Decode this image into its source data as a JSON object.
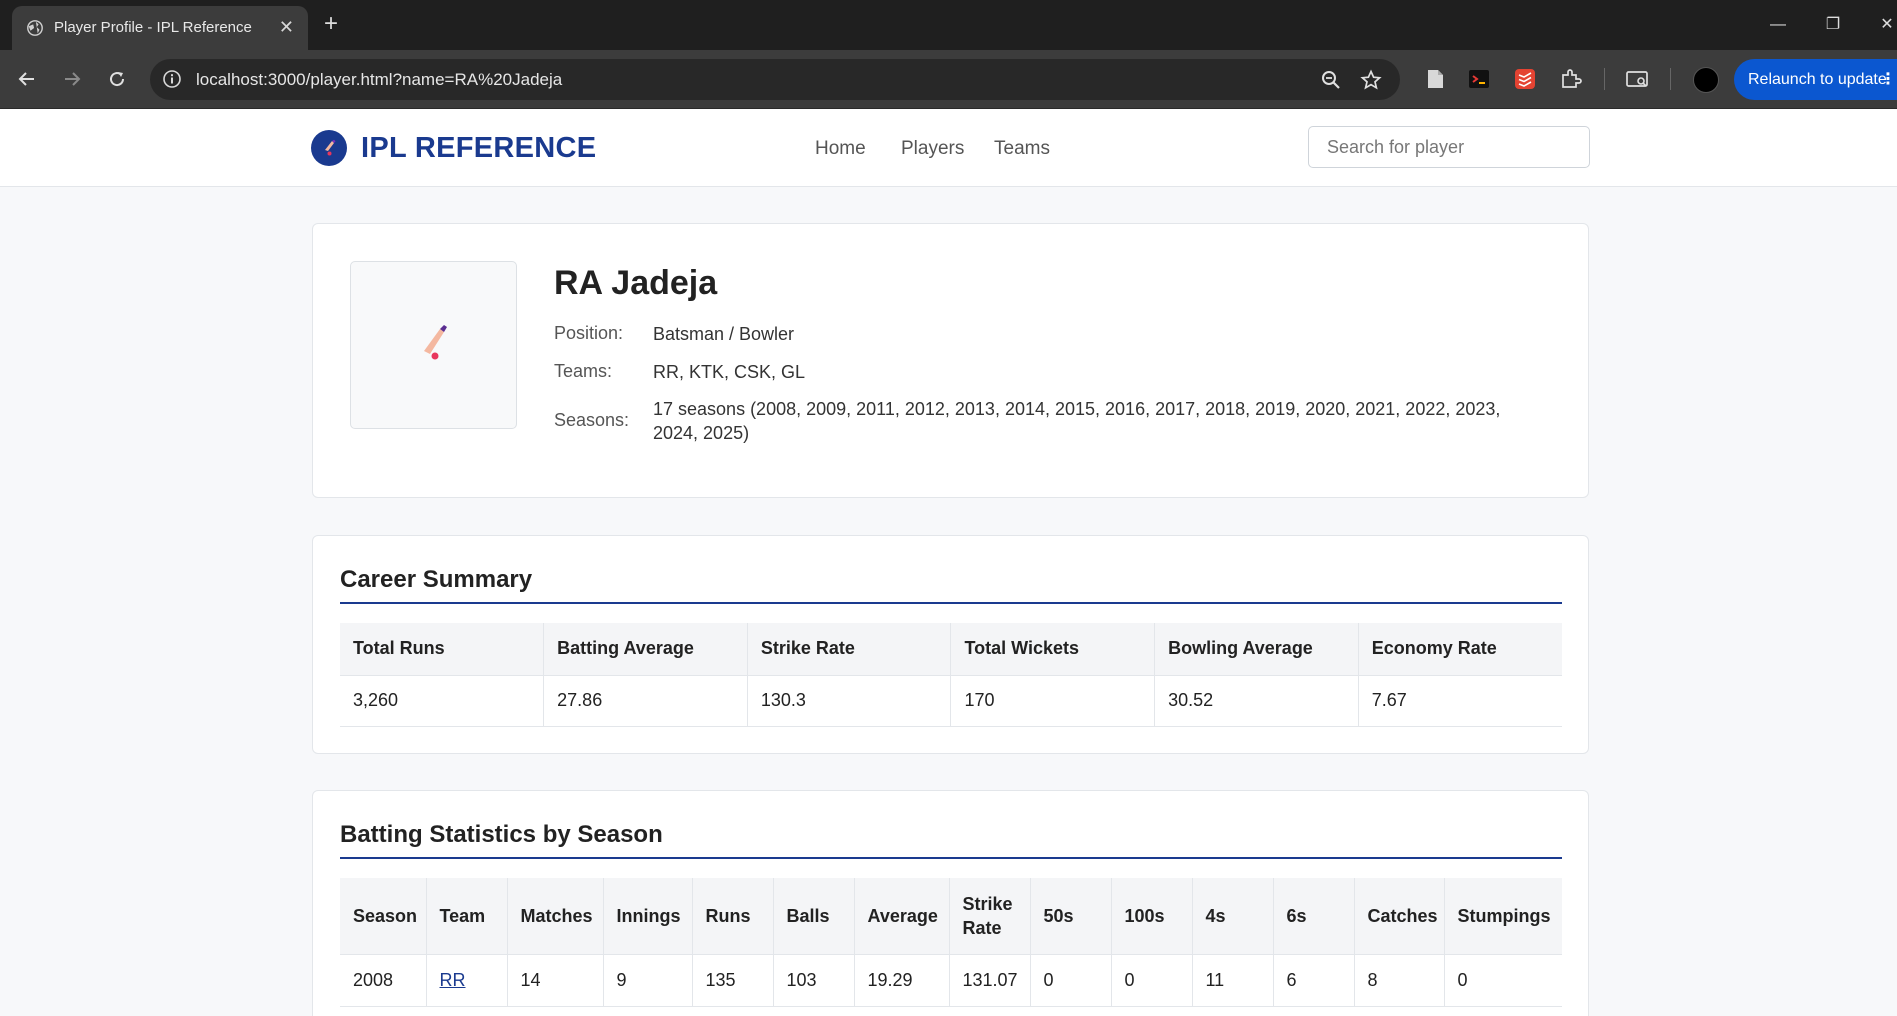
{
  "browser": {
    "tab_title": "Player Profile - IPL Reference",
    "url": "localhost:3000/player.html?name=RA%20Jadeja",
    "relaunch_label": "Relaunch to update"
  },
  "site": {
    "logo_text": "IPL REFERENCE",
    "nav": [
      "Home",
      "Players",
      "Teams"
    ],
    "search_placeholder": "Search for player"
  },
  "player": {
    "name": "RA Jadeja",
    "position_label": "Position:",
    "position": "Batsman / Bowler",
    "teams_label": "Teams:",
    "teams": "RR, KTK, CSK, GL",
    "seasons_label": "Seasons:",
    "seasons": "17 seasons (2008, 2009, 2011, 2012, 2013, 2014, 2015, 2016, 2017, 2018, 2019, 2020, 2021, 2022, 2023, 2024, 2025)"
  },
  "career_summary": {
    "title": "Career Summary",
    "headers": [
      "Total Runs",
      "Batting Average",
      "Strike Rate",
      "Total Wickets",
      "Bowling Average",
      "Economy Rate"
    ],
    "values": [
      "3,260",
      "27.86",
      "130.3",
      "170",
      "30.52",
      "7.67"
    ]
  },
  "batting": {
    "title": "Batting Statistics by Season",
    "headers": [
      "Season",
      "Team",
      "Matches",
      "Innings",
      "Runs",
      "Balls",
      "Average",
      "Strike Rate",
      "50s",
      "100s",
      "4s",
      "6s",
      "Catches",
      "Stumpings"
    ],
    "rows": [
      [
        "2008",
        "RR",
        "14",
        "9",
        "135",
        "103",
        "19.29",
        "131.07",
        "0",
        "0",
        "11",
        "6",
        "8",
        "0"
      ]
    ]
  },
  "colors": {
    "brand": "#1a3a8f",
    "chrome_dark": "#1f1f1f",
    "relaunch_blue": "#0b57d0"
  }
}
